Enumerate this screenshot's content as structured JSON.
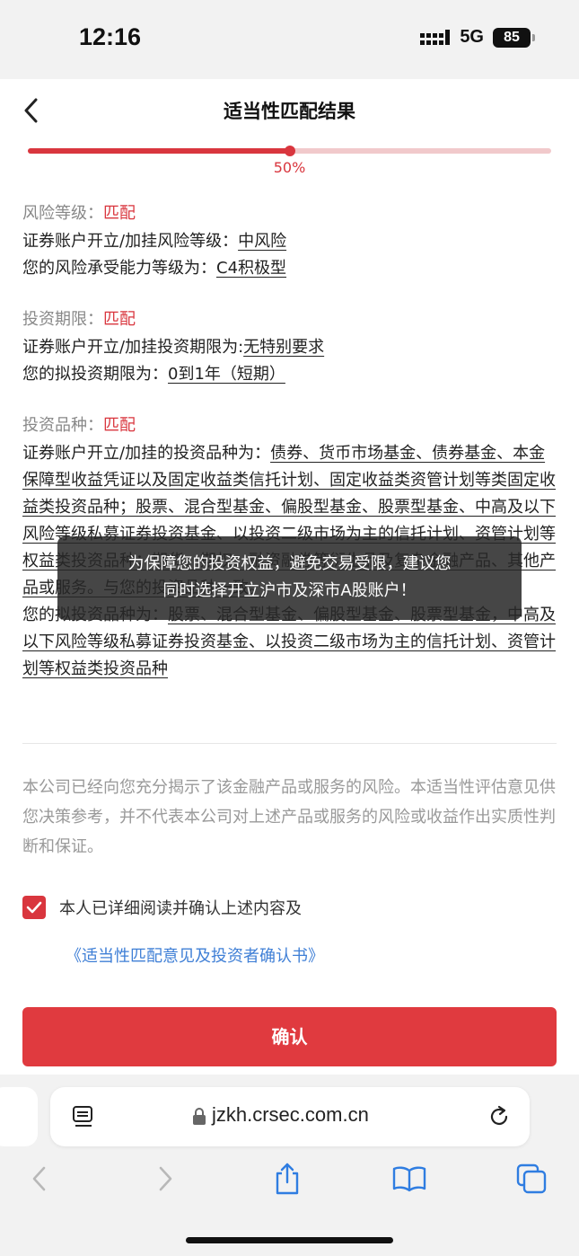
{
  "status_bar": {
    "time": "12:16",
    "network": "5G",
    "battery": "85"
  },
  "header": {
    "title": "适当性匹配结果"
  },
  "progress": {
    "value": 0.5,
    "label": "50%"
  },
  "sections": [
    {
      "head_label": "风险等级：",
      "head_status": "匹配",
      "lines": [
        {
          "prefix": "证券账户开立/加挂风险等级：",
          "value": "中风险"
        },
        {
          "prefix": "您的风险承受能力等级为：",
          "value": "C4积极型"
        }
      ]
    },
    {
      "head_label": "投资期限：",
      "head_status": "匹配",
      "lines": [
        {
          "prefix": "证券账户开立/加挂投资期限为:",
          "value": "无特别要求"
        },
        {
          "prefix": "您的拟投资期限为：",
          "value": "0到1年（短期）"
        }
      ]
    }
  ],
  "product_section": {
    "head_label": "投资品种：",
    "head_status": "匹配",
    "account_prefix": "证券账户开立/加挂的投资品种为：",
    "account_value": "债券、货币市场基金、债券基金、本金保障型收益凭证以及固定收益类信托计划、固定收益类资管计划等类固定收益类投资品种；股票、混合型基金、偏股型基金、股票型基金、中高及以下风险等级私募证券投资基金、以投资二级市场为主的信托计划、资管计划等权益类投资品种；期货、期权、融资融券等衍生品及复杂金融产品、其他产品或服务。与您的投资品种一致。",
    "user_prefix": "您的拟投资品种为：",
    "user_value": "股票、混合型基金、偏股型基金、股票型基金，中高及以下风险等级私募证券投资基金、以投资二级市场为主的信托计划、资管计划等权益类投资品种"
  },
  "toast": {
    "line1": "为保障您的投资权益，避免交易受限，建议您",
    "line2": "同时选择开立沪市及深市A股账户！"
  },
  "disclaimer": "本公司已经向您充分揭示了该金融产品或服务的风险。本适当性评估意见供您决策参考，并不代表本公司对上述产品或服务的风险或收益作出实质性判断和保证。",
  "agreement": {
    "checked": true,
    "text": "本人已详细阅读并确认上述内容及",
    "link": "《适当性匹配意见及投资者确认书》"
  },
  "confirm_button": "确认",
  "browser": {
    "url": "jzkh.crsec.com.cn",
    "icons": [
      "reader-icon",
      "lock-icon",
      "reload-icon",
      "back-icon",
      "forward-icon",
      "share-icon",
      "bookmarks-icon",
      "tabs-icon"
    ]
  },
  "colors": {
    "accent": "#d9363e",
    "link": "#3f7fd6",
    "muted": "#999999"
  }
}
